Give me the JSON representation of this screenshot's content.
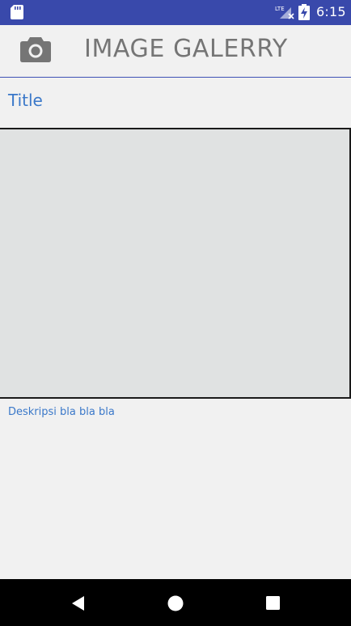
{
  "status_bar": {
    "time": "6:15",
    "network_label": "LTE",
    "icons": [
      "sd-card-icon",
      "lte-signal-icon",
      "battery-charging-icon"
    ]
  },
  "header": {
    "title": "IMAGE GALERRY",
    "icon": "camera-icon"
  },
  "item": {
    "title": "Title",
    "description": "Deskripsi bla bla bla"
  },
  "nav_bar": {
    "buttons": [
      "back-icon",
      "home-icon",
      "recents-icon"
    ]
  },
  "colors": {
    "status_bar": "#3949ab",
    "accent_text": "#3a78c9",
    "header_title": "#757575",
    "background": "#f1f1f1",
    "image_placeholder": "#e0e2e2",
    "nav_bar": "#000000"
  }
}
